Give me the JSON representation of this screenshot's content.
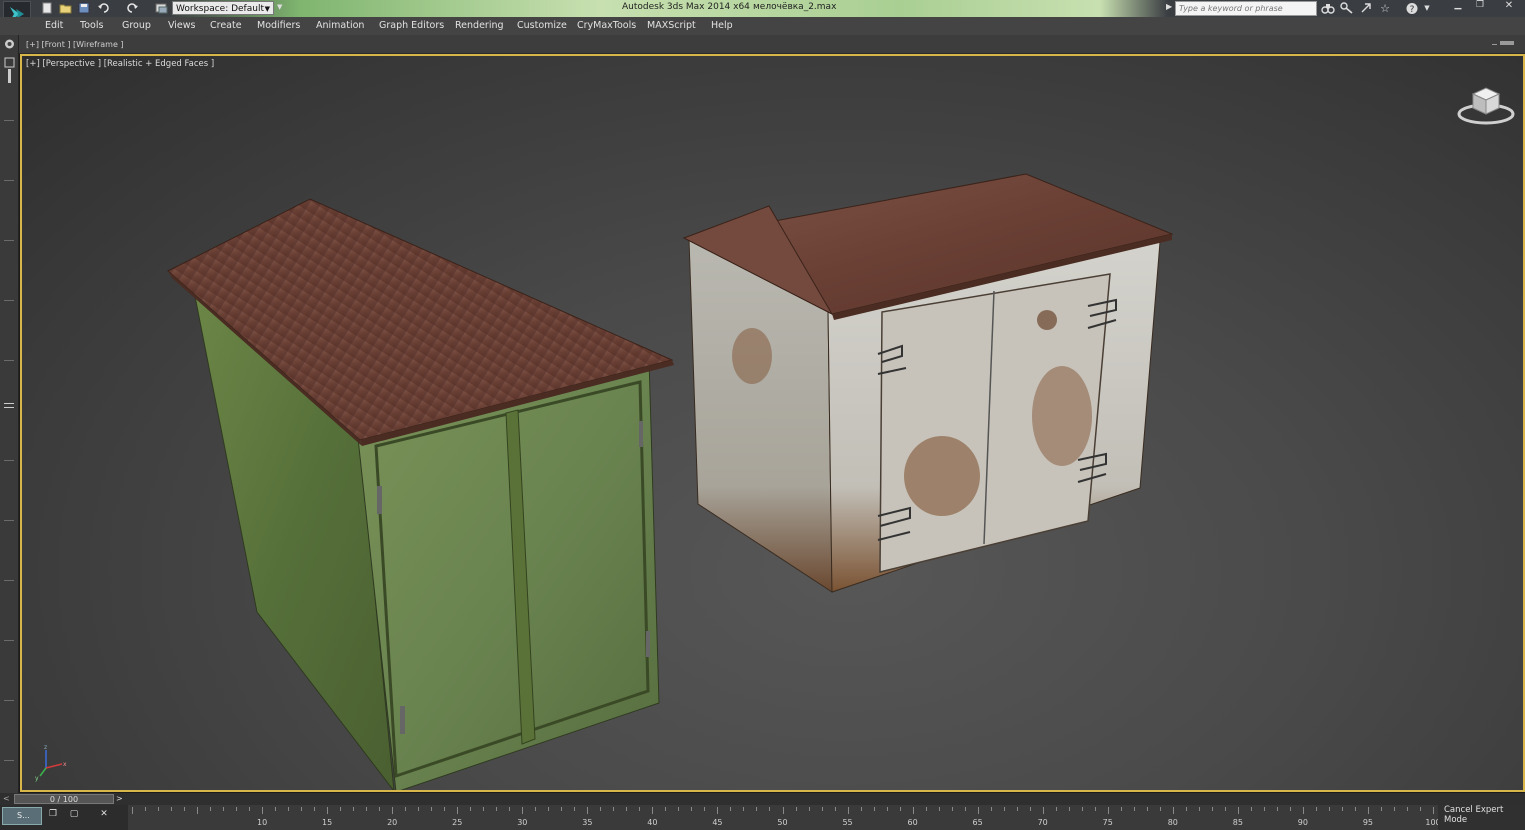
{
  "titlebar": {
    "workspace_label": "Workspace: Default",
    "app_title": "Autodesk 3ds Max  2014 x64",
    "file_title": "мелочёвка_2.max",
    "search_placeholder": "Type a keyword or phrase"
  },
  "menu": [
    "Edit",
    "Tools",
    "Group",
    "Views",
    "Create",
    "Modifiers",
    "Animation",
    "Graph Editors",
    "Rendering",
    "Customize",
    "CryMaxTools",
    "MAXScript",
    "Help"
  ],
  "viewports": {
    "front_label": "[+] [Front ] [Wireframe ]",
    "perspective_label": "[+] [Perspective ] [Realistic + Edged Faces ]"
  },
  "timeline": {
    "frame_display": "0 / 100",
    "prev": "<",
    "next": ">",
    "ticks": [
      "10",
      "15",
      "20",
      "25",
      "30",
      "35",
      "40",
      "45",
      "50",
      "55",
      "60",
      "65",
      "70",
      "75",
      "80",
      "85",
      "90",
      "95",
      "100"
    ]
  },
  "status": {
    "taskbar_label": "S...",
    "expert_mode_label": "Cancel Expert Mode"
  },
  "colors": {
    "viewport_border": "#d9b64a",
    "green_shed": "#5f7a3a",
    "rust_roof": "#6b3f2e",
    "white_shed": "#c9c9c3"
  }
}
